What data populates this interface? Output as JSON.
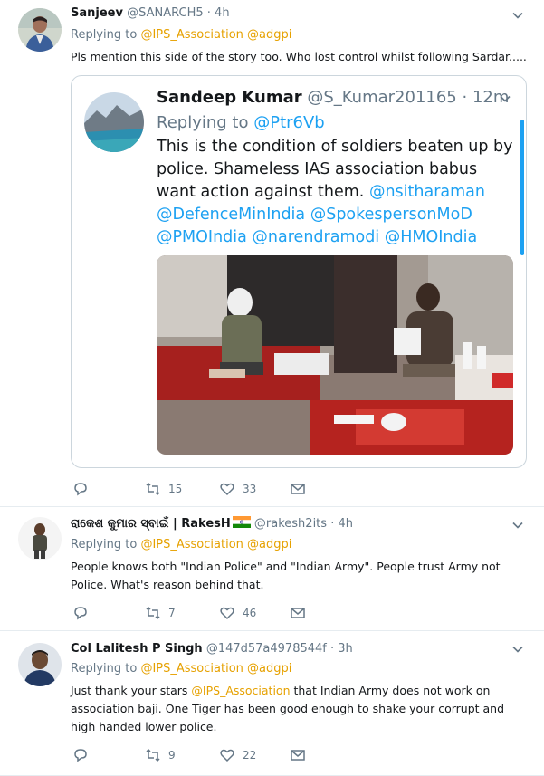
{
  "tweets": [
    {
      "name": "Sanjeev",
      "handle": "@SANARCH5",
      "time": "4h",
      "replying_prefix": "Replying to",
      "replying_to": "@IPS_Association @adgpi",
      "text": "Pls mention this side of the story too. Who lost control whilst following Sardar.....",
      "retweets": "15",
      "likes": "33",
      "quote": {
        "name": "Sandeep Kumar",
        "handle": "@S_Kumar201165",
        "time": "12m",
        "replying_prefix": "Replying to",
        "replying_to": "@Ptr6Vb",
        "text": "This is the condition of soldiers beaten up by police. Shameless IAS association babus want action against them.",
        "links": "@nsitharaman @DefenceMinIndia @SpokespersonMoD @PMOIndia @narendramodi @HMOIndia"
      }
    },
    {
      "name": "ରାକେଶ କୁମାର ସ୍ବାଇଁ | RakesH",
      "handle": "@rakesh2its",
      "time": "4h",
      "replying_prefix": "Replying to",
      "replying_to": "@IPS_Association @adgpi",
      "text": "People knows both \"Indian Police\" and \"Indian Army\". People trust Army not Police. What's reason behind that.",
      "retweets": "7",
      "likes": "46"
    },
    {
      "name": "Col Lalitesh P Singh",
      "handle": "@147d57a4978544f",
      "time": "3h",
      "replying_prefix": "Replying to",
      "replying_to": "@IPS_Association @adgpi",
      "text_before": "Just thank your stars",
      "text_mention": "@IPS_Association",
      "text_after": "that Indian Army does not work on association baji. One Tiger has been good enough to shake your corrupt and high handed lower police.",
      "retweets": "9",
      "likes": "22"
    }
  ],
  "colors": {
    "mention": "#e6a100",
    "link": "#1da1f2",
    "secondary": "#657786"
  }
}
